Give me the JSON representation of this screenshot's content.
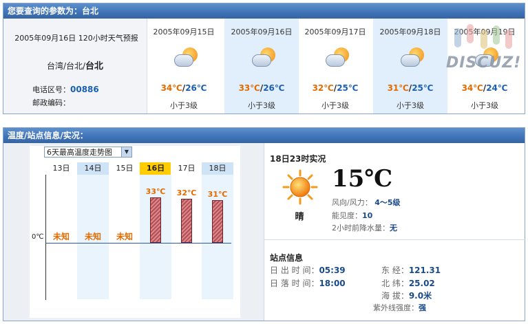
{
  "header": {
    "title": "您要查询的参数为：台北"
  },
  "summary": {
    "forecast_title": "2005年09月16日 120小时天气预报",
    "location_prefix": "台湾/台北/",
    "location_city": "台北",
    "area_code_label": "电话区号：",
    "area_code": "00886",
    "postal_code_label": "邮政编码："
  },
  "days": [
    {
      "date": "2005年09月15日",
      "high": "34℃",
      "sep": "/",
      "low": "26℃",
      "wind": "小于3级",
      "icon": "partly-cloudy-icon"
    },
    {
      "date": "2005年09月16日",
      "high": "33℃",
      "sep": "/",
      "low": "26℃",
      "wind": "小于3级",
      "icon": "partly-cloudy-icon"
    },
    {
      "date": "2005年09月17日",
      "high": "32℃",
      "sep": "/",
      "low": "25℃",
      "wind": "小于3级",
      "icon": "partly-cloudy-icon"
    },
    {
      "date": "2005年09月18日",
      "high": "31℃",
      "sep": "/",
      "low": "25℃",
      "wind": "小于3级",
      "icon": "partly-cloudy-icon"
    },
    {
      "date": "2005年09月19日",
      "high": "34℃",
      "sep": "/",
      "low": "24℃",
      "wind": "小于3级",
      "icon": "partly-cloudy-icon"
    }
  ],
  "watermark": {
    "text": "DISCUZ!"
  },
  "section2": {
    "title": "温度/站点信息/实况："
  },
  "chart_control": {
    "select_value": "6天最高温度走势图"
  },
  "chart_data": {
    "type": "bar",
    "categories": [
      "13日",
      "14日",
      "15日",
      "16日",
      "17日",
      "18日"
    ],
    "values": [
      null,
      null,
      null,
      33,
      32,
      31
    ],
    "value_labels": [
      "未知",
      "未知",
      "未知",
      "33℃",
      "32℃",
      "31℃"
    ],
    "unknown_label": "未知",
    "zero_label": "0℃",
    "highlight_category": "16日",
    "colors": {
      "bar": "#c0555b",
      "highlight": "#ffcc00",
      "column_tint": "#eaf4fd"
    }
  },
  "live": {
    "title": "18日23时实况",
    "temperature": "15℃",
    "condition": "晴",
    "icon": "sun-icon",
    "wind_label": "风向/风力：",
    "wind_value": "4～5级",
    "visibility_label": "能见度：",
    "visibility_value": "10",
    "precip_label": "2小时前降水量：",
    "precip_value": "无"
  },
  "station": {
    "title": "站点信息",
    "sunrise_label": "日 出 时 间：",
    "sunrise_value": "05:39",
    "sunset_label": "日 落 时 间：",
    "sunset_value": "18:00",
    "lon_label": "东 经：",
    "lon_value": "121.31",
    "lat_label": "北 纬：",
    "lat_value": "25.02",
    "alt_label": "海 拔：",
    "alt_value": "9.0米",
    "uv_label": "紫外线强度：",
    "uv_value": "强"
  }
}
